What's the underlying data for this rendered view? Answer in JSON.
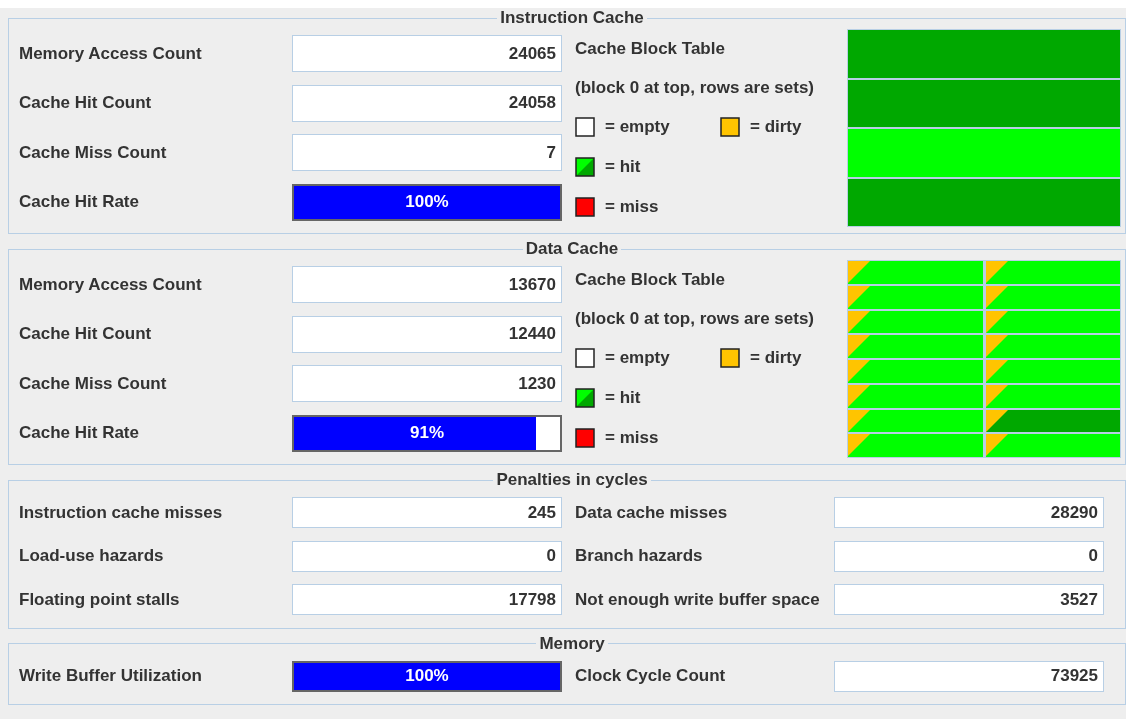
{
  "sections": [
    {
      "kind": "cache",
      "title": "Instruction Cache",
      "stats": [
        {
          "kind": "field",
          "label": "Memory Access Count",
          "value": "24065"
        },
        {
          "kind": "field",
          "label": "Cache Hit Count",
          "value": "24058"
        },
        {
          "kind": "field",
          "label": "Cache Miss Count",
          "value": "7"
        },
        {
          "kind": "bar",
          "label": "Cache Hit Rate",
          "level": 1,
          "reading": "100%"
        }
      ],
      "table": {
        "title": "Cache Block Table",
        "subtitle": "(block 0 at top, rows are sets)",
        "legend": [
          {
            "kind": "empty",
            "label": "= empty"
          },
          {
            "kind": "dirty",
            "label": "= dirty"
          },
          {
            "kind": "hit",
            "label": "= hit"
          },
          {
            "kind": "miss",
            "label": "= miss"
          }
        ],
        "rows": [
          [
            {
              "kind": "hit",
              "recent": false,
              "dirty": false
            }
          ],
          [
            {
              "kind": "hit",
              "recent": false,
              "dirty": false
            }
          ],
          [
            {
              "kind": "hit",
              "recent": true,
              "dirty": false
            }
          ],
          [
            {
              "kind": "hit",
              "recent": false,
              "dirty": false
            }
          ]
        ]
      }
    },
    {
      "kind": "cache",
      "title": "Data Cache",
      "stats": [
        {
          "kind": "field",
          "label": "Memory Access Count",
          "value": "13670"
        },
        {
          "kind": "field",
          "label": "Cache Hit Count",
          "value": "12440"
        },
        {
          "kind": "field",
          "label": "Cache Miss Count",
          "value": "1230"
        },
        {
          "kind": "bar",
          "label": "Cache Hit Rate",
          "level": 0.91,
          "reading": "91%"
        }
      ],
      "table": {
        "title": "Cache Block Table",
        "subtitle": "(block 0 at top, rows are sets)",
        "legend": [
          {
            "kind": "empty",
            "label": "= empty"
          },
          {
            "kind": "dirty",
            "label": "= dirty"
          },
          {
            "kind": "hit",
            "label": "= hit"
          },
          {
            "kind": "miss",
            "label": "= miss"
          }
        ],
        "rows": [
          [
            {
              "kind": "hit",
              "recent": true,
              "dirty": true
            },
            {
              "kind": "hit",
              "recent": true,
              "dirty": true
            }
          ],
          [
            {
              "kind": "hit",
              "recent": true,
              "dirty": true
            },
            {
              "kind": "hit",
              "recent": true,
              "dirty": true
            }
          ],
          [
            {
              "kind": "hit",
              "recent": true,
              "dirty": true
            },
            {
              "kind": "hit",
              "recent": true,
              "dirty": true
            }
          ],
          [
            {
              "kind": "hit",
              "recent": true,
              "dirty": true
            },
            {
              "kind": "hit",
              "recent": true,
              "dirty": true
            }
          ],
          [
            {
              "kind": "hit",
              "recent": true,
              "dirty": true
            },
            {
              "kind": "hit",
              "recent": true,
              "dirty": true
            }
          ],
          [
            {
              "kind": "hit",
              "recent": true,
              "dirty": true
            },
            {
              "kind": "hit",
              "recent": true,
              "dirty": true
            }
          ],
          [
            {
              "kind": "hit",
              "recent": true,
              "dirty": true
            },
            {
              "kind": "hit",
              "recent": false,
              "dirty": true
            }
          ],
          [
            {
              "kind": "hit",
              "recent": true,
              "dirty": true
            },
            {
              "kind": "hit",
              "recent": true,
              "dirty": true
            }
          ]
        ]
      }
    },
    {
      "kind": "pairs",
      "title": "Penalties in cycles",
      "items": [
        {
          "kind": "field",
          "label": "Instruction cache misses",
          "value": "245"
        },
        {
          "kind": "field",
          "label": "Data cache misses",
          "value": "28290"
        },
        {
          "kind": "field",
          "label": "Load-use hazards",
          "value": "0"
        },
        {
          "kind": "field",
          "label": "Branch hazards",
          "value": "0"
        },
        {
          "kind": "field",
          "label": "Floating point stalls",
          "value": "17798"
        },
        {
          "kind": "field",
          "label": "Not enough write buffer space",
          "value": "3527"
        }
      ]
    },
    {
      "kind": "pairs",
      "title": "Memory",
      "items": [
        {
          "kind": "bar",
          "label": "Write Buffer Utilization",
          "level": 1,
          "reading": "100%"
        },
        {
          "kind": "field",
          "label": "Clock Cycle Count",
          "value": "73925"
        }
      ]
    }
  ]
}
